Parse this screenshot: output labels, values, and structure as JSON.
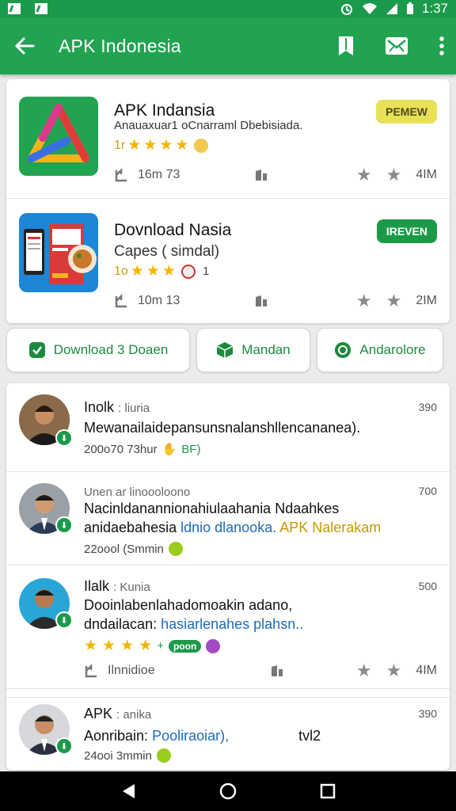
{
  "status_bar": {
    "time": "1:37"
  },
  "app_bar": {
    "title": "APK Indonesia"
  },
  "apps": [
    {
      "name": "APK Indansia",
      "subtitle": "Anauaxuar1 oCnarraml Dbebisiada.",
      "rating_prefix": "1r",
      "badge": "PEMEW",
      "downloads": "16m 73",
      "size": "4IM",
      "colors": {
        "badge_bg": "#e9e05a"
      }
    },
    {
      "name": "Dovnload Nasia",
      "subtitle": "Capes ( simdal)",
      "rating_prefix": "1o",
      "rating_extra": "1",
      "badge": "IREVEN",
      "downloads": "10m 13",
      "size": "2IM",
      "colors": {
        "badge_bg": "#1c9a48"
      }
    }
  ],
  "actions": [
    {
      "label": "Download 3 Doaen",
      "icon": "shield-check-icon"
    },
    {
      "label": "Mandan",
      "icon": "cube-icon"
    },
    {
      "label": "Andarolore",
      "icon": "smile-icon"
    }
  ],
  "posts": [
    {
      "author": "Inolk",
      "author_suffix": ": liuria",
      "count": "390",
      "text": "Mewanailaidepansunsnalanshllencananea).",
      "footer": "200o70 73hur",
      "footer_tag": "BF)"
    },
    {
      "author": "Unen ar linoooloono",
      "count": "700",
      "text": "Nacinldanannionahiulaahania Ndaahkes",
      "text2_prefix": "anidaebahesia ",
      "text2_blue": "ldnio dlanooka.",
      "text2_yellow": "APK Nalerakam",
      "footer": "22oool (Smmin"
    },
    {
      "author": "Ilalk",
      "author_suffix": ": Kunia",
      "count": "500",
      "text": "Dooinlabenlahadomoakin adano,",
      "text2_prefix": "dndailacan: ",
      "text2_blue": "hasiarlenahes plahsn..",
      "tag": "poon",
      "meta": "Ilnnidioe",
      "size": "4IM"
    },
    {
      "author": "APK",
      "author_suffix": ": anika",
      "count": "390",
      "text_prefix": "Aonribain: ",
      "text_blue": "Pooliraoiar),",
      "text_suffix": "tvl2",
      "footer": "24ooi 3mmin"
    }
  ]
}
